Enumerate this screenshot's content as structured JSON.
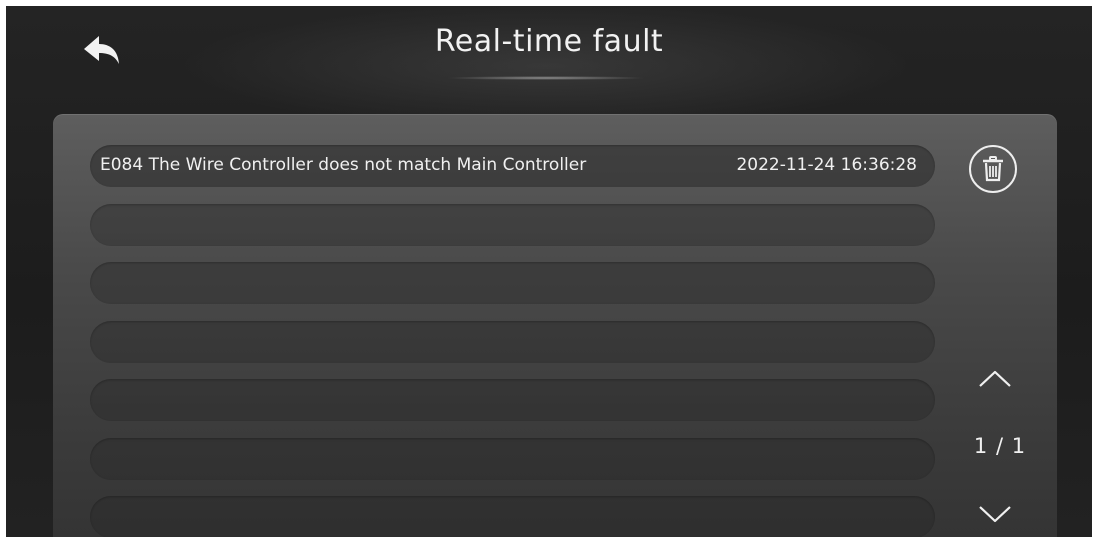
{
  "header": {
    "title": "Real-time fault",
    "back_icon": "back-arrow-icon"
  },
  "faults": [
    {
      "text": "E084 The Wire Controller does not match Main Controller",
      "time": "2022-11-24 16:36:28"
    },
    {
      "text": "",
      "time": ""
    },
    {
      "text": "",
      "time": ""
    },
    {
      "text": "",
      "time": ""
    },
    {
      "text": "",
      "time": ""
    },
    {
      "text": "",
      "time": ""
    },
    {
      "text": "",
      "time": ""
    }
  ],
  "controls": {
    "delete_icon": "trash-icon",
    "page_up_icon": "chevron-up-icon",
    "page_down_icon": "chevron-down-icon",
    "page_indicator": "1 / 1"
  },
  "colors": {
    "text": "#f0f0f0",
    "background": "#1f1f1f",
    "panel": "#4a4a4a"
  }
}
